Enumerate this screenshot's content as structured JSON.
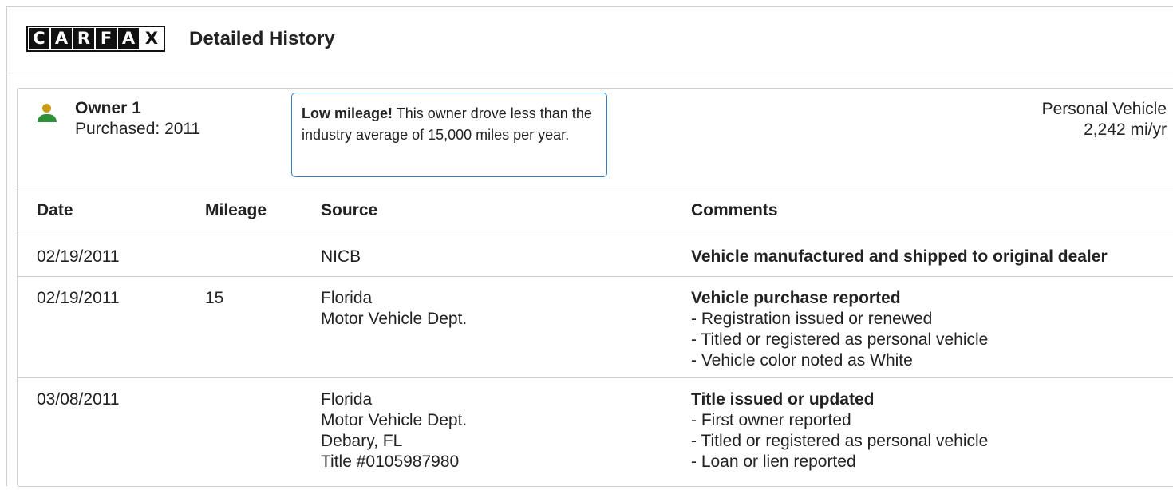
{
  "logo": {
    "letters": [
      "C",
      "A",
      "R",
      "F",
      "A",
      "X"
    ]
  },
  "header": {
    "title": "Detailed History"
  },
  "owner": {
    "name": "Owner 1",
    "purchased": "Purchased: 2011",
    "note_bold": "Low mileage!",
    "note_text": " This owner drove less than the industry average of 15,000 miles per year.",
    "vehicle_type": "Personal Vehicle",
    "miles_per_year": "2,242 mi/yr"
  },
  "table": {
    "headers": {
      "date": "Date",
      "mileage": "Mileage",
      "source": "Source",
      "comments": "Comments"
    },
    "rows": [
      {
        "date": "02/19/2011",
        "mileage": "",
        "source": [
          "NICB"
        ],
        "comment_title": "Vehicle manufactured and shipped to original dealer",
        "comment_lines": []
      },
      {
        "date": "02/19/2011",
        "mileage": "15",
        "source": [
          "Florida",
          "Motor Vehicle Dept."
        ],
        "comment_title": "Vehicle purchase reported",
        "comment_lines": [
          "Registration issued or renewed",
          "Titled or registered as personal vehicle",
          "Vehicle color noted as White"
        ]
      },
      {
        "date": "03/08/2011",
        "mileage": "",
        "source": [
          "Florida",
          "Motor Vehicle Dept.",
          "Debary, FL",
          "Title #0105987980"
        ],
        "comment_title": "Title issued or updated",
        "comment_lines": [
          "First owner reported",
          "Titled or registered as personal vehicle",
          "Loan or lien reported"
        ]
      }
    ]
  },
  "colors": {
    "owner_head": "#c79b13",
    "owner_body": "#2f8f3a",
    "note_border": "#2f80c9"
  }
}
